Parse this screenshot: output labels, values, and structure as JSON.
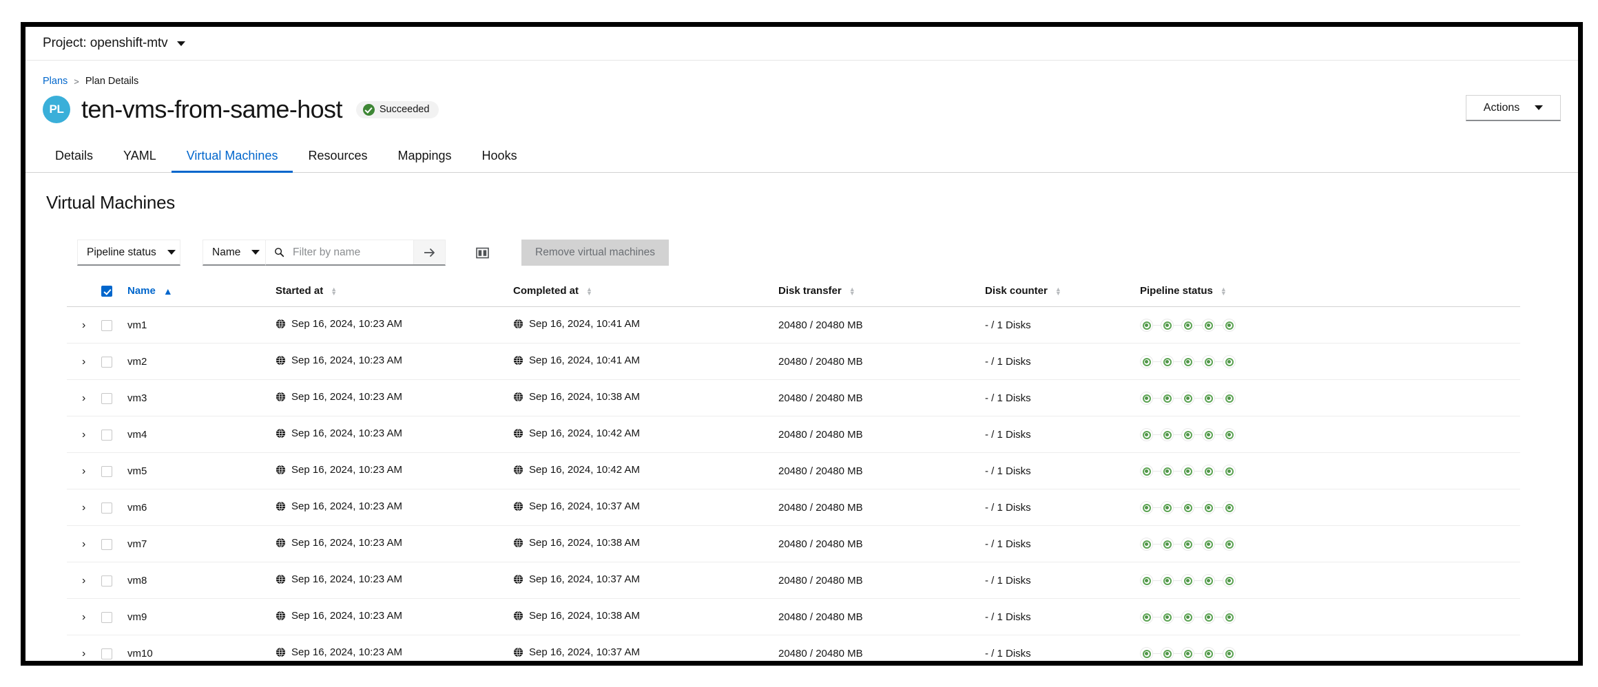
{
  "project_bar": {
    "label": "Project: openshift-mtv",
    "caret_icon": "chevron-down-icon"
  },
  "breadcrumb": {
    "root": "Plans",
    "separator": ">",
    "current": "Plan Details"
  },
  "header": {
    "badge": "PL",
    "badge_color": "#3aafd9",
    "title": "ten-vms-from-same-host",
    "status": "Succeeded",
    "status_color": "#3e8635",
    "actions_label": "Actions"
  },
  "tabs": [
    {
      "label": "Details",
      "active": false
    },
    {
      "label": "YAML",
      "active": false
    },
    {
      "label": "Virtual Machines",
      "active": true
    },
    {
      "label": "Resources",
      "active": false
    },
    {
      "label": "Mappings",
      "active": false
    },
    {
      "label": "Hooks",
      "active": false
    }
  ],
  "section": {
    "title": "Virtual Machines"
  },
  "toolbar": {
    "pipeline_status_select": "Pipeline status",
    "attribute_select": "Name",
    "search_placeholder": "Filter by name",
    "search_value": "",
    "search_submit_icon": "arrow-right-icon",
    "columns_icon": "manage-columns-icon",
    "remove_button": "Remove virtual machines"
  },
  "table": {
    "select_all_checked": true,
    "columns": [
      {
        "label": "Name",
        "sort": "asc"
      },
      {
        "label": "Started at",
        "sort": "none"
      },
      {
        "label": "Completed at",
        "sort": "none"
      },
      {
        "label": "Disk transfer",
        "sort": "none"
      },
      {
        "label": "Disk counter",
        "sort": "none"
      },
      {
        "label": "Pipeline status",
        "sort": "none"
      }
    ],
    "rows": [
      {
        "name": "vm1",
        "started": "Sep 16, 2024, 10:23 AM",
        "completed": "Sep 16, 2024, 10:41 AM",
        "transfer": "20480 / 20480 MB",
        "counter": "- / 1 Disks",
        "pipeline_steps": 5,
        "pipeline_state": "success",
        "selected": false
      },
      {
        "name": "vm2",
        "started": "Sep 16, 2024, 10:23 AM",
        "completed": "Sep 16, 2024, 10:41 AM",
        "transfer": "20480 / 20480 MB",
        "counter": "- / 1 Disks",
        "pipeline_steps": 5,
        "pipeline_state": "success",
        "selected": false
      },
      {
        "name": "vm3",
        "started": "Sep 16, 2024, 10:23 AM",
        "completed": "Sep 16, 2024, 10:38 AM",
        "transfer": "20480 / 20480 MB",
        "counter": "- / 1 Disks",
        "pipeline_steps": 5,
        "pipeline_state": "success",
        "selected": false
      },
      {
        "name": "vm4",
        "started": "Sep 16, 2024, 10:23 AM",
        "completed": "Sep 16, 2024, 10:42 AM",
        "transfer": "20480 / 20480 MB",
        "counter": "- / 1 Disks",
        "pipeline_steps": 5,
        "pipeline_state": "success",
        "selected": false
      },
      {
        "name": "vm5",
        "started": "Sep 16, 2024, 10:23 AM",
        "completed": "Sep 16, 2024, 10:42 AM",
        "transfer": "20480 / 20480 MB",
        "counter": "- / 1 Disks",
        "pipeline_steps": 5,
        "pipeline_state": "success",
        "selected": false
      },
      {
        "name": "vm6",
        "started": "Sep 16, 2024, 10:23 AM",
        "completed": "Sep 16, 2024, 10:37 AM",
        "transfer": "20480 / 20480 MB",
        "counter": "- / 1 Disks",
        "pipeline_steps": 5,
        "pipeline_state": "success",
        "selected": false
      },
      {
        "name": "vm7",
        "started": "Sep 16, 2024, 10:23 AM",
        "completed": "Sep 16, 2024, 10:38 AM",
        "transfer": "20480 / 20480 MB",
        "counter": "- / 1 Disks",
        "pipeline_steps": 5,
        "pipeline_state": "success",
        "selected": false
      },
      {
        "name": "vm8",
        "started": "Sep 16, 2024, 10:23 AM",
        "completed": "Sep 16, 2024, 10:37 AM",
        "transfer": "20480 / 20480 MB",
        "counter": "- / 1 Disks",
        "pipeline_steps": 5,
        "pipeline_state": "success",
        "selected": false
      },
      {
        "name": "vm9",
        "started": "Sep 16, 2024, 10:23 AM",
        "completed": "Sep 16, 2024, 10:38 AM",
        "transfer": "20480 / 20480 MB",
        "counter": "- / 1 Disks",
        "pipeline_steps": 5,
        "pipeline_state": "success",
        "selected": false
      },
      {
        "name": "vm10",
        "started": "Sep 16, 2024, 10:23 AM",
        "completed": "Sep 16, 2024, 10:37 AM",
        "transfer": "20480 / 20480 MB",
        "counter": "- / 1 Disks",
        "pipeline_steps": 5,
        "pipeline_state": "success",
        "selected": false
      }
    ],
    "row_expand_icon": "chevron-right-icon",
    "timestamp_icon": "globe-icon"
  }
}
